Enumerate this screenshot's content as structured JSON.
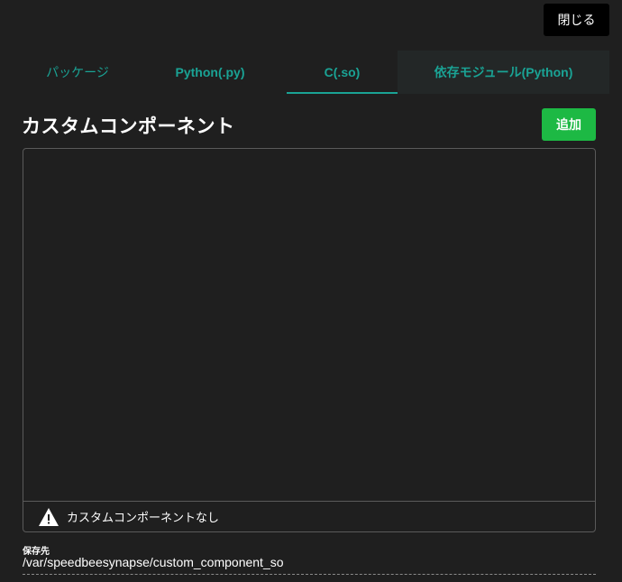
{
  "header": {
    "close_label": "閉じる"
  },
  "tabs": [
    {
      "label": "パッケージ",
      "active": false
    },
    {
      "label": "Python(.py)",
      "active": false
    },
    {
      "label": "C(.so)",
      "active": true
    },
    {
      "label": "依存モジュール(Python)",
      "active": false
    }
  ],
  "main": {
    "title": "カスタムコンポーネント",
    "add_label": "追加",
    "empty_message": "カスタムコンポーネントなし",
    "empty_icon": "warning-icon"
  },
  "save": {
    "label": "保存先",
    "path": "/var/speedbeesynapse/custom_component_so"
  },
  "colors": {
    "background": "#1f1f1f",
    "accent": "#1aa395",
    "add_button": "#1db944",
    "close_button": "#000000"
  }
}
